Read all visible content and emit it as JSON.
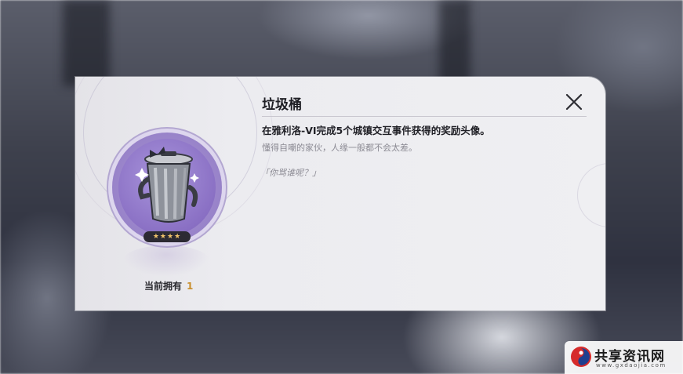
{
  "dialog": {
    "title": "垃圾桶",
    "description": "在雅利洛-VI完成5个城镇交互事件获得的奖励头像。",
    "flavor_text": "懂得自嘲的家伙，人缘一般都不会太差。",
    "quote": "「你骂谁呢？」",
    "close_icon": "close-icon"
  },
  "item": {
    "avatar_icon": "trash-can-icon",
    "rarity_stars": "★★★★",
    "rarity": 4,
    "owned_label": "当前拥有",
    "owned_count": "1"
  },
  "watermark": {
    "text": "共享资讯网",
    "subtext": "www.gxdaojia.com"
  },
  "colors": {
    "avatar_bg": "#9b86cb",
    "owned_count": "#c98f2d",
    "star": "#f1c36a"
  }
}
